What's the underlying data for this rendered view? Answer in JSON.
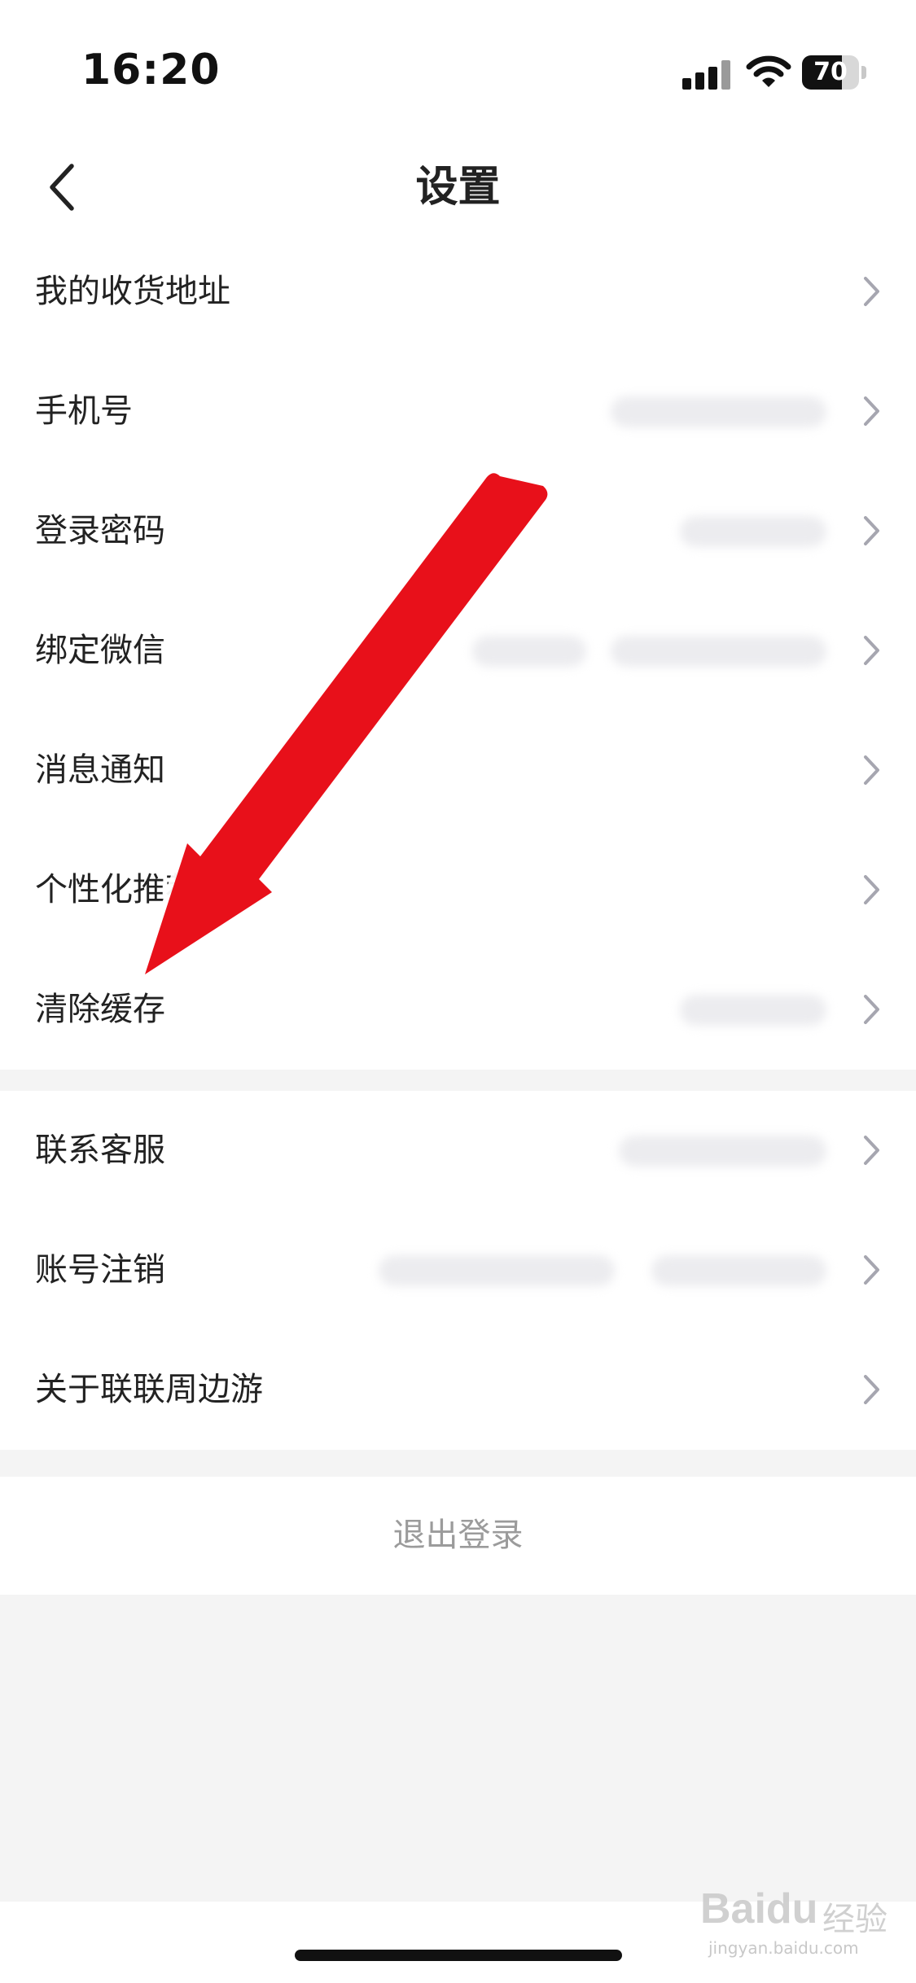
{
  "status_bar": {
    "time": "16:20",
    "battery": "70",
    "battery_level": 0.7
  },
  "header": {
    "title": "设置"
  },
  "group1": [
    {
      "label": "我的收货地址"
    },
    {
      "label": "手机号"
    },
    {
      "label": "登录密码"
    },
    {
      "label": "绑定微信"
    },
    {
      "label": "消息通知"
    },
    {
      "label": "个性化推荐"
    },
    {
      "label": "清除缓存"
    }
  ],
  "group2": [
    {
      "label": "联系客服"
    },
    {
      "label": "账号注销"
    },
    {
      "label": "关于联联周边游"
    }
  ],
  "logout": {
    "label": "退出登录"
  },
  "annotation": {
    "color": "#e8101a"
  },
  "watermark": {
    "brand": "Baidu",
    "brand2": "经验",
    "url": "jingyan.baidu.com"
  },
  "icons": {
    "back": "chevron-left-icon",
    "row": "chevron-right-icon"
  }
}
